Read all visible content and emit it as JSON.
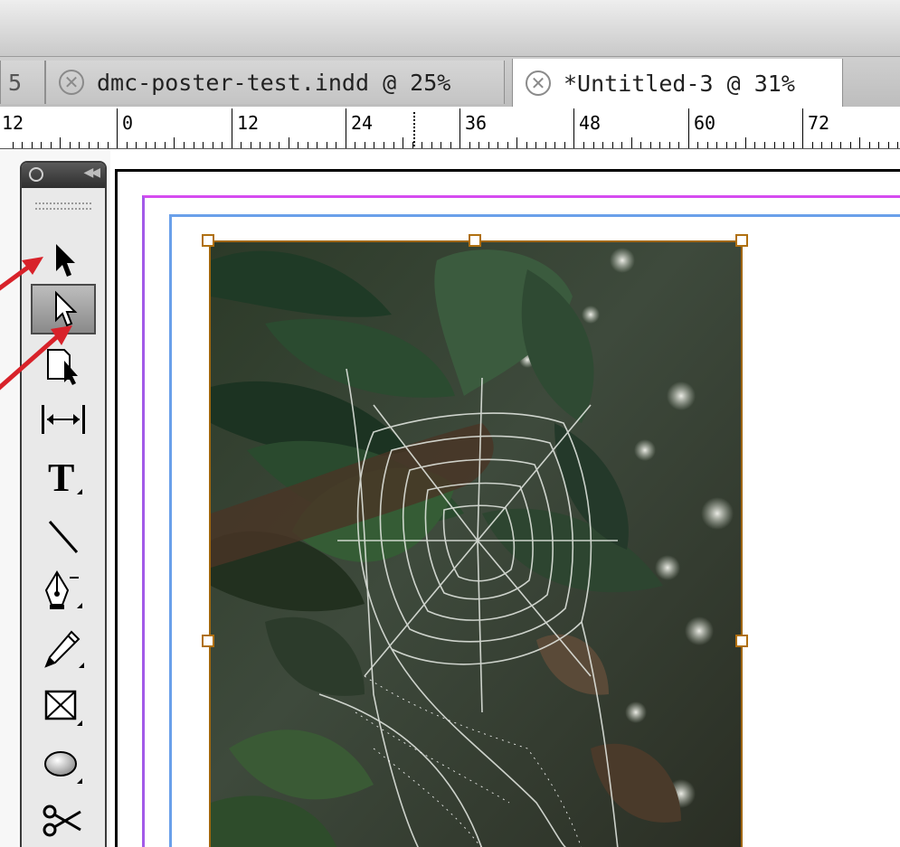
{
  "tabs": [
    {
      "label": "5",
      "state": "partial"
    },
    {
      "label": "dmc-poster-test.indd @ 25%",
      "state": "inactive"
    },
    {
      "label": "*Untitled-3 @ 31%",
      "state": "active"
    }
  ],
  "ruler": {
    "labels": [
      "12",
      "0",
      "12",
      "24",
      "36",
      "48",
      "60",
      "72"
    ]
  },
  "tools_panel": {
    "tools": [
      {
        "name": "selection-tool",
        "icon": "black-arrow-icon"
      },
      {
        "name": "direct-selection-tool",
        "icon": "white-arrow-icon",
        "selected": true
      },
      {
        "name": "page-tool",
        "icon": "page-arrow-icon"
      },
      {
        "name": "gap-tool",
        "icon": "gap-arrows-icon"
      },
      {
        "name": "type-tool",
        "icon": "type-T-icon"
      },
      {
        "name": "line-tool",
        "icon": "line-icon"
      },
      {
        "name": "pen-tool",
        "icon": "pen-nib-icon"
      },
      {
        "name": "pencil-tool",
        "icon": "pencil-icon"
      },
      {
        "name": "rectangle-frame-tool",
        "icon": "x-box-icon"
      },
      {
        "name": "ellipse-tool",
        "icon": "ellipse-icon"
      },
      {
        "name": "scissors-tool",
        "icon": "scissors-icon"
      }
    ]
  },
  "colors": {
    "margin_guide": "#d54cf0",
    "column_guide": "#6aa0ea",
    "frame_stroke": "#a0660c",
    "annotation_arrow": "#d8222a"
  },
  "canvas": {
    "image_description": "spider-web-photo"
  }
}
